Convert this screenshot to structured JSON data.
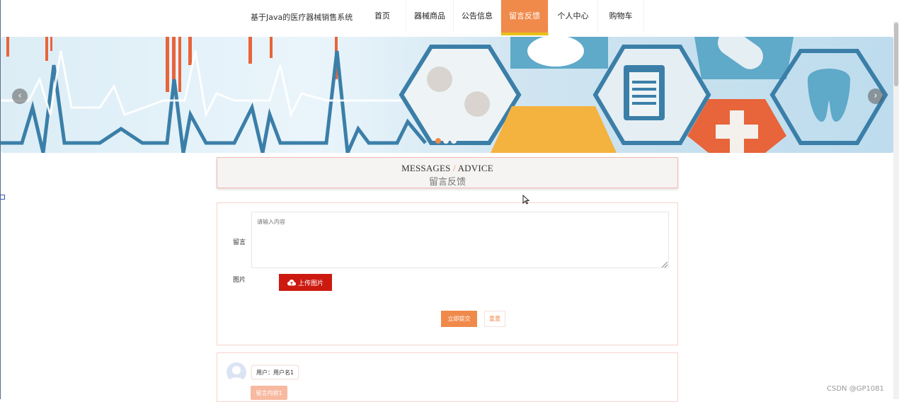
{
  "header": {
    "site_title": "基于Java的医疗器械销售系统",
    "nav": [
      {
        "label": "首页",
        "active": false
      },
      {
        "label": "器械商品",
        "active": false
      },
      {
        "label": "公告信息",
        "active": false
      },
      {
        "label": "留言反馈",
        "active": true
      },
      {
        "label": "个人中心",
        "active": false
      },
      {
        "label": "购物车",
        "active": false
      }
    ]
  },
  "banner": {
    "prev_icon": "chevron-left-icon",
    "next_icon": "chevron-right-icon",
    "slide_count": 3,
    "active_slide": 1
  },
  "section": {
    "title_en_left": "MESSAGES",
    "title_slash": "/",
    "title_en_right": "ADVICE",
    "title_cn": "留言反馈"
  },
  "form": {
    "message_label": "留言",
    "message_placeholder": "请输入内容",
    "image_label": "图片",
    "upload_label": "上传图片",
    "upload_icon": "cloud-upload-icon",
    "submit_label": "立即提交",
    "reset_label": "重置"
  },
  "messages": [
    {
      "user_label": "用户：用户名1",
      "content_tag": "留言内容1"
    }
  ],
  "watermark": "CSDN @GP1081",
  "colors": {
    "accent": "#f08a4b",
    "nav_underline": "#e8c01a",
    "upload_button": "#cc1a10",
    "card_border": "#f6d3cd"
  }
}
